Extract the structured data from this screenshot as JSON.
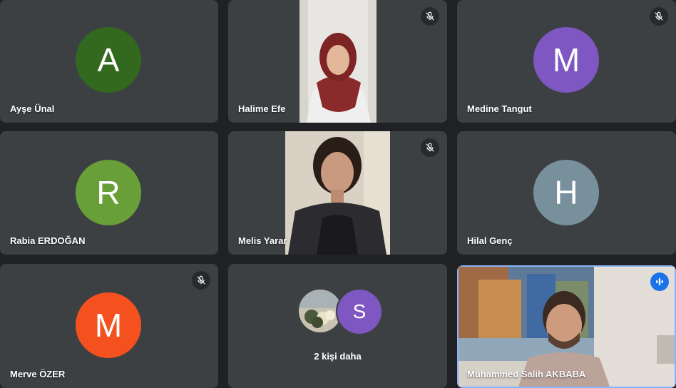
{
  "participants": [
    {
      "name": "Ayşe Ünal",
      "initial": "A",
      "color": "#33691e",
      "muted": false
    },
    {
      "name": "Halime Efe",
      "video": true,
      "muted": true
    },
    {
      "name": "Medine Tangut",
      "initial": "M",
      "color": "#7e57c2",
      "muted": true
    },
    {
      "name": "Rabia ERDOĞAN",
      "initial": "R",
      "color": "#689f38",
      "muted": false
    },
    {
      "name": "Melis Yarar",
      "video": true,
      "muted": true
    },
    {
      "name": "Hilal Genç",
      "initial": "H",
      "color": "#78909c",
      "muted": false
    },
    {
      "name": "Merve ÖZER",
      "initial": "M",
      "color": "#f4511e",
      "muted": true
    },
    {
      "name": "Muhammed Salih AKBABA",
      "video": true,
      "speaking": true,
      "muted": false
    }
  ],
  "more_tile": {
    "label": "2 kişi daha",
    "avatar_initial": "S",
    "avatar_color": "#7e57c2"
  },
  "colors": {
    "background": "#202124",
    "tile": "#3c4043",
    "active_speaker_border": "#8ab4f8",
    "speaking_indicator": "#1a73e8"
  },
  "icons": [
    "mic-off-icon",
    "speaking-indicator-icon"
  ]
}
